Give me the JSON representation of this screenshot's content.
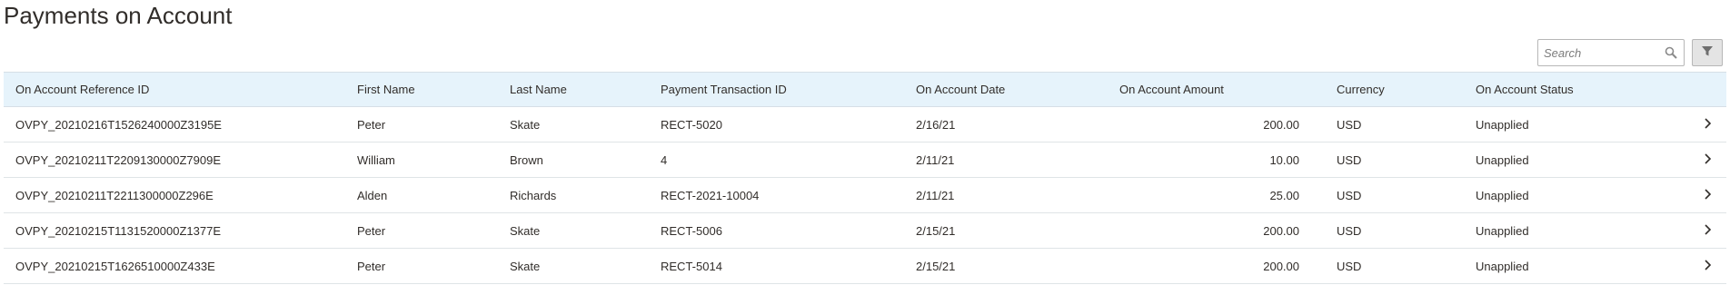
{
  "header": {
    "title": "Payments on Account"
  },
  "toolbar": {
    "search_placeholder": "Search",
    "search_icon": "magnifier-icon",
    "filter_icon": "funnel-icon"
  },
  "table": {
    "columns": [
      "On Account Reference ID",
      "First Name",
      "Last Name",
      "Payment Transaction ID",
      "On Account Date",
      "On Account Amount",
      "Currency",
      "On Account Status"
    ],
    "rows": [
      {
        "ref": "OVPY_20210216T1526240000Z3195E",
        "first": "Peter",
        "last": "Skate",
        "txn": "RECT-5020",
        "date": "2/16/21",
        "amount": "200.00",
        "currency": "USD",
        "status": "Unapplied"
      },
      {
        "ref": "OVPY_20210211T2209130000Z7909E",
        "first": "William",
        "last": "Brown",
        "txn": "4",
        "date": "2/11/21",
        "amount": "10.00",
        "currency": "USD",
        "status": "Unapplied"
      },
      {
        "ref": "OVPY_20210211T2211300000Z296E",
        "first": "Alden",
        "last": "Richards",
        "txn": "RECT-2021-10004",
        "date": "2/11/21",
        "amount": "25.00",
        "currency": "USD",
        "status": "Unapplied"
      },
      {
        "ref": "OVPY_20210215T1131520000Z1377E",
        "first": "Peter",
        "last": "Skate",
        "txn": "RECT-5006",
        "date": "2/15/21",
        "amount": "200.00",
        "currency": "USD",
        "status": "Unapplied"
      },
      {
        "ref": "OVPY_20210215T1626510000Z433E",
        "first": "Peter",
        "last": "Skate",
        "txn": "RECT-5014",
        "date": "2/15/21",
        "amount": "200.00",
        "currency": "USD",
        "status": "Unapplied"
      }
    ]
  },
  "colors": {
    "header_bg": "#e6f3fb",
    "text": "#312d2a",
    "row_border": "#dfe4e7"
  }
}
